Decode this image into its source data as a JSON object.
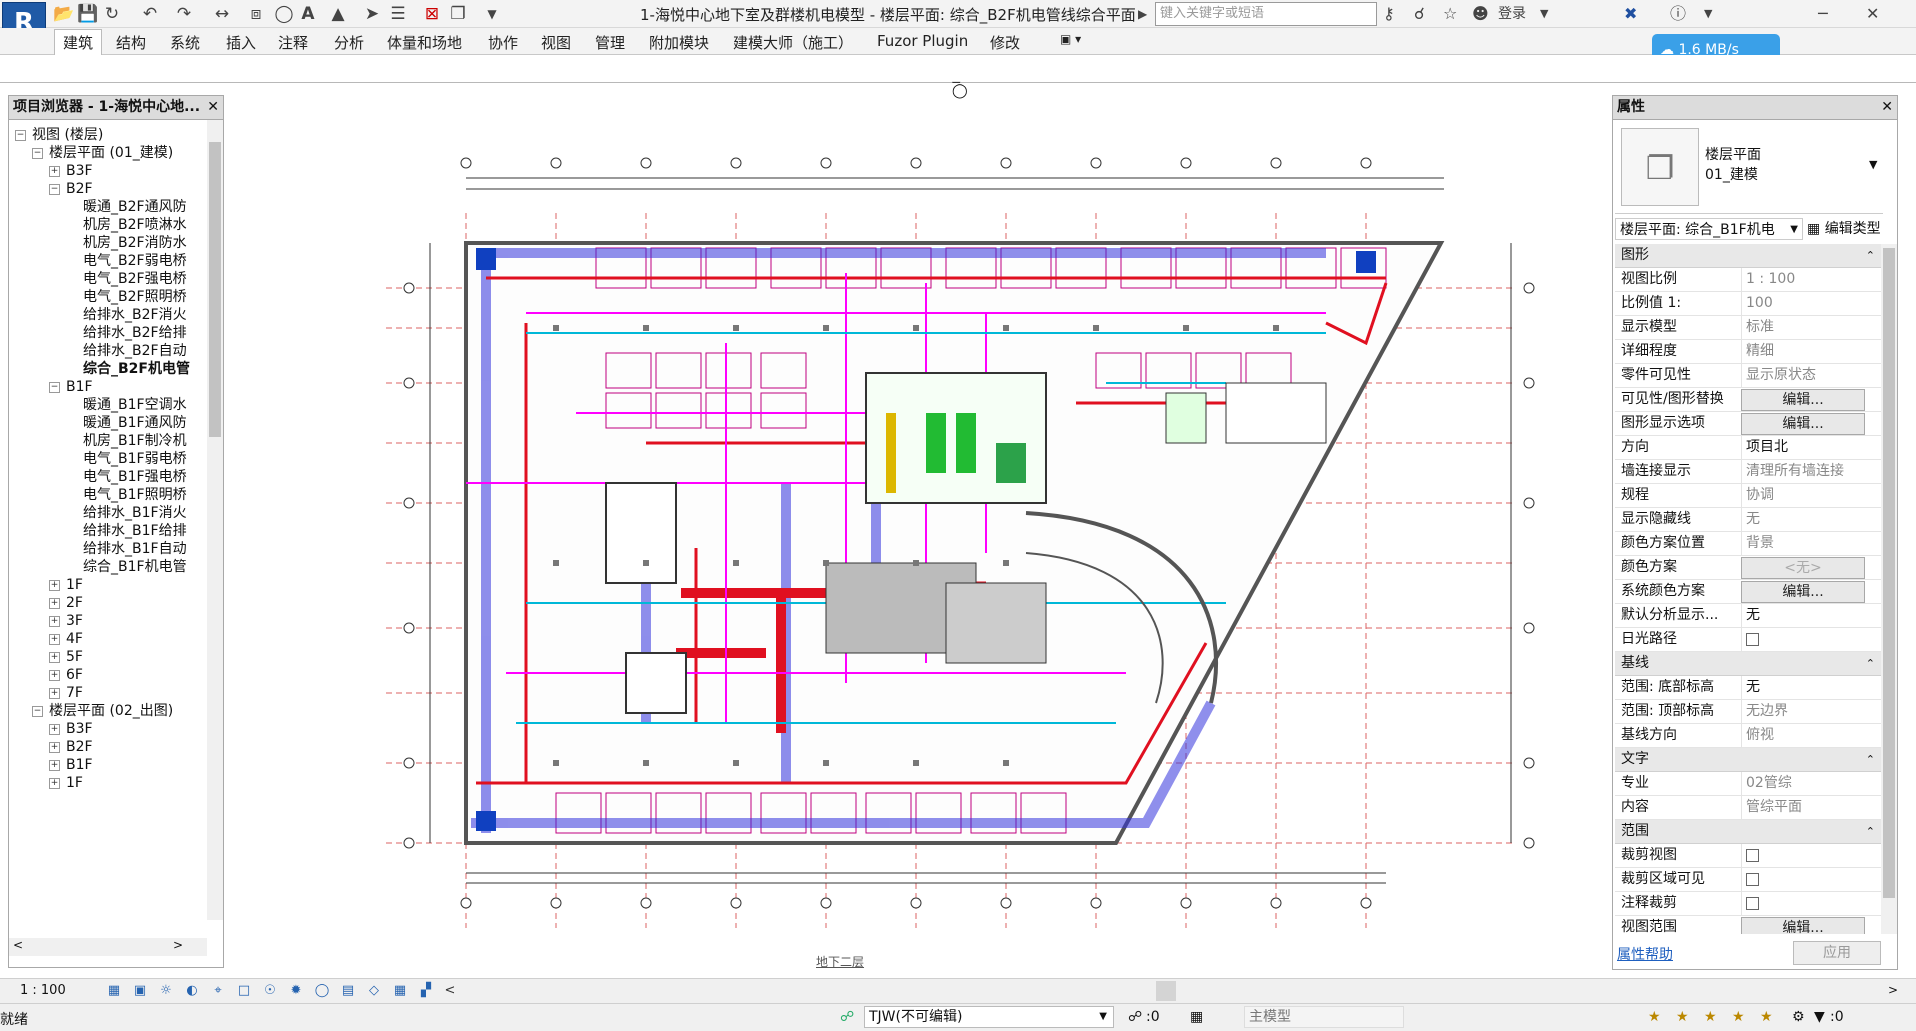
{
  "app": {
    "logo": "R",
    "title": "1-海悦中心地下室及群楼机电模型 - 楼层平面: 综合_B2F机电管线综合平面"
  },
  "quick_access": [
    "open-icon",
    "save-icon",
    "sync-icon",
    "undo-icon",
    "redo-icon",
    "measure-icon",
    "align-icon",
    "tag-icon",
    "text-icon",
    "3d-icon",
    "section-icon",
    "thin-lines-icon",
    "close-hidden-icon",
    "switch-windows-icon",
    "dropdown-icon"
  ],
  "search": {
    "placeholder": "键入关键字或短语"
  },
  "login": {
    "label": "登录"
  },
  "tabs": [
    "建筑",
    "结构",
    "系统",
    "插入",
    "注释",
    "分析",
    "体量和场地",
    "协作",
    "视图",
    "管理",
    "附加模块",
    "建模大师（施工）",
    "Fuzor Plugin",
    "修改"
  ],
  "speed": {
    "label": "1.6 MB/s"
  },
  "browser": {
    "title": "项目浏览器 - 1-海悦中心地...",
    "nodes": [
      {
        "text": "视图 (楼层)",
        "level": 0,
        "exp": "-"
      },
      {
        "text": "楼层平面 (01_建模)",
        "level": 1,
        "exp": "-"
      },
      {
        "text": "B3F",
        "level": 2,
        "exp": "+"
      },
      {
        "text": "B2F",
        "level": 2,
        "exp": "-"
      },
      {
        "text": "暖通_B2F通风防",
        "level": 3,
        "exp": ""
      },
      {
        "text": "机房_B2F喷淋水",
        "level": 3,
        "exp": ""
      },
      {
        "text": "机房_B2F消防水",
        "level": 3,
        "exp": ""
      },
      {
        "text": "电气_B2F弱电桥",
        "level": 3,
        "exp": ""
      },
      {
        "text": "电气_B2F强电桥",
        "level": 3,
        "exp": ""
      },
      {
        "text": "电气_B2F照明桥",
        "level": 3,
        "exp": ""
      },
      {
        "text": "给排水_B2F消火",
        "level": 3,
        "exp": ""
      },
      {
        "text": "给排水_B2F给排",
        "level": 3,
        "exp": ""
      },
      {
        "text": "给排水_B2F自动",
        "level": 3,
        "exp": ""
      },
      {
        "text": "综合_B2F机电管",
        "level": 3,
        "exp": "",
        "bold": true
      },
      {
        "text": "B1F",
        "level": 2,
        "exp": "-"
      },
      {
        "text": "暖通_B1F空调水",
        "level": 3,
        "exp": ""
      },
      {
        "text": "暖通_B1F通风防",
        "level": 3,
        "exp": ""
      },
      {
        "text": "机房_B1F制冷机",
        "level": 3,
        "exp": ""
      },
      {
        "text": "电气_B1F弱电桥",
        "level": 3,
        "exp": ""
      },
      {
        "text": "电气_B1F强电桥",
        "level": 3,
        "exp": ""
      },
      {
        "text": "电气_B1F照明桥",
        "level": 3,
        "exp": ""
      },
      {
        "text": "给排水_B1F消火",
        "level": 3,
        "exp": ""
      },
      {
        "text": "给排水_B1F给排",
        "level": 3,
        "exp": ""
      },
      {
        "text": "给排水_B1F自动",
        "level": 3,
        "exp": ""
      },
      {
        "text": "综合_B1F机电管",
        "level": 3,
        "exp": ""
      },
      {
        "text": "1F",
        "level": 2,
        "exp": "+"
      },
      {
        "text": "2F",
        "level": 2,
        "exp": "+"
      },
      {
        "text": "3F",
        "level": 2,
        "exp": "+"
      },
      {
        "text": "4F",
        "level": 2,
        "exp": "+"
      },
      {
        "text": "5F",
        "level": 2,
        "exp": "+"
      },
      {
        "text": "6F",
        "level": 2,
        "exp": "+"
      },
      {
        "text": "7F",
        "level": 2,
        "exp": "+"
      },
      {
        "text": "楼层平面 (02_出图)",
        "level": 1,
        "exp": "-"
      },
      {
        "text": "B3F",
        "level": 2,
        "exp": "+"
      },
      {
        "text": "B2F",
        "level": 2,
        "exp": "+"
      },
      {
        "text": "B1F",
        "level": 2,
        "exp": "+"
      },
      {
        "text": "1F",
        "level": 2,
        "exp": "+"
      }
    ]
  },
  "drawing": {
    "caption": "地下二层"
  },
  "properties": {
    "title": "属性",
    "type_name": "楼层平面",
    "type_sub": "01_建模",
    "selector": "楼层平面: 综合_B1F机电",
    "edit_type": "编辑类型",
    "sections": [
      {
        "name": "图形",
        "rows": [
          {
            "k": "视图比例",
            "v": "1 : 100",
            "grey": true
          },
          {
            "k": "比例值 1:",
            "v": "100",
            "grey": true
          },
          {
            "k": "显示模型",
            "v": "标准",
            "grey": true
          },
          {
            "k": "详细程度",
            "v": "精细",
            "grey": true
          },
          {
            "k": "零件可见性",
            "v": "显示原状态",
            "grey": true
          },
          {
            "k": "可见性/图形替换",
            "btn": "编辑..."
          },
          {
            "k": "图形显示选项",
            "btn": "编辑..."
          },
          {
            "k": "方向",
            "v": "项目北"
          },
          {
            "k": "墙连接显示",
            "v": "清理所有墙连接",
            "grey": true
          },
          {
            "k": "规程",
            "v": "协调",
            "grey": true
          },
          {
            "k": "显示隐藏线",
            "v": "无",
            "grey": true
          },
          {
            "k": "颜色方案位置",
            "v": "背景",
            "grey": true
          },
          {
            "k": "颜色方案",
            "btn": "<无>",
            "dis": true
          },
          {
            "k": "系统颜色方案",
            "btn": "编辑..."
          },
          {
            "k": "默认分析显示...",
            "v": "无"
          },
          {
            "k": "日光路径",
            "cb": true
          }
        ]
      },
      {
        "name": "基线",
        "rows": [
          {
            "k": "范围: 底部标高",
            "v": "无"
          },
          {
            "k": "范围: 顶部标高",
            "v": "无边界",
            "grey": true
          },
          {
            "k": "基线方向",
            "v": "俯视",
            "grey": true
          }
        ]
      },
      {
        "name": "文字",
        "rows": [
          {
            "k": "专业",
            "v": "02管综",
            "grey": true
          },
          {
            "k": "内容",
            "v": "管综平面",
            "grey": true
          }
        ]
      },
      {
        "name": "范围",
        "rows": [
          {
            "k": "裁剪视图",
            "cb": true
          },
          {
            "k": "裁剪区域可见",
            "cb": true
          },
          {
            "k": "注释裁剪",
            "cb": true
          },
          {
            "k": "视图范围",
            "btn": "编辑..."
          }
        ]
      }
    ],
    "help": "属性帮助",
    "apply": "应用"
  },
  "view_ctrl": {
    "scale": "1 : 100"
  },
  "status": {
    "ready": "就绪",
    "workset": "TJW(不可编辑)",
    "zero1": ":0",
    "model": "主模型",
    "zero2": ":0"
  }
}
